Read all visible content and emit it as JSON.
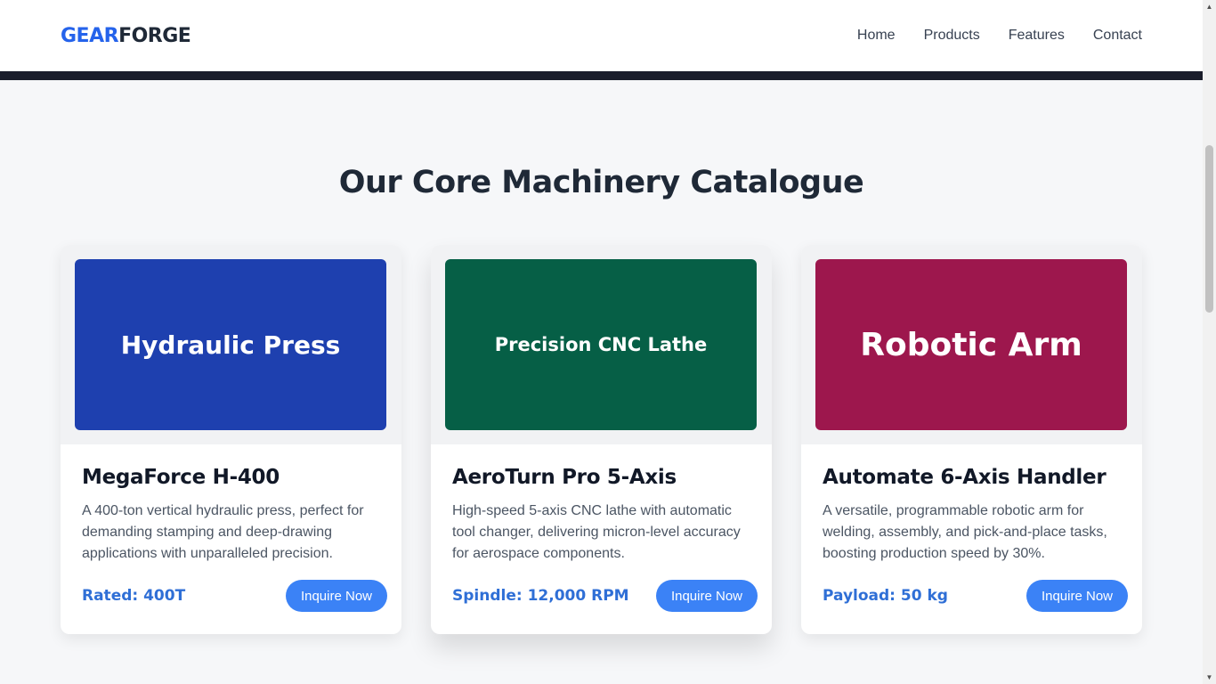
{
  "header": {
    "logo_part1": "GEAR",
    "logo_part2": "FORGE",
    "nav": [
      "Home",
      "Products",
      "Features",
      "Contact"
    ]
  },
  "main": {
    "title": "Our Core Machinery Catalogue",
    "cards": [
      {
        "image_label": "Hydraulic Press",
        "image_color": "#1e40af",
        "name": "MegaForce H-400",
        "description": "A 400-ton vertical hydraulic press, perfect for demanding stamping and deep-drawing applications with unparalleled precision.",
        "spec": "Rated: 400T",
        "button": "Inquire Now"
      },
      {
        "image_label": "Precision CNC Lathe",
        "image_color": "#065f46",
        "name": "AeroTurn Pro 5-Axis",
        "description": "High-speed 5-axis CNC lathe with automatic tool changer, delivering micron-level accuracy for aerospace components.",
        "spec": "Spindle: 12,000 RPM",
        "button": "Inquire Now"
      },
      {
        "image_label": "Robotic Arm",
        "image_color": "#9d174d",
        "name": "Automate 6-Axis Handler",
        "description": "A versatile, programmable robotic arm for welding, assembly, and pick-and-place tasks, boosting production speed by 30%.",
        "spec": "Payload: 50 kg",
        "button": "Inquire Now"
      }
    ]
  },
  "colors": {
    "accent": "#3b82f6",
    "logo_accent": "#2563eb"
  }
}
